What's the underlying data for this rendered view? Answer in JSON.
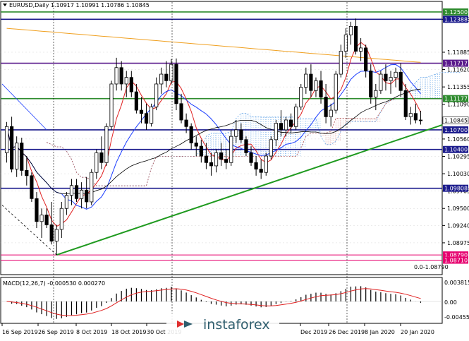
{
  "header": {
    "symbol_line": "EURUSD,Daily  1.10917 1.10991 1.10786 1.10845"
  },
  "macd_label": "MACD(12,26,7) -0.000530 0.000270",
  "macd_axis": [
    "0.003815",
    "0.00",
    "-0.004556"
  ],
  "fib_label": "0.0-1.08790",
  "watermark": "instaforex",
  "colors": {
    "bull": "#ffffff",
    "bear": "#000000",
    "level_blue": "#1a1a8c",
    "level_green": "#2e8b2e",
    "level_purple": "#5a1a8c",
    "level_magenta": "#e6006e",
    "trend": "#1f9a1f",
    "red_ma": "#e02020",
    "blue_ma": "#1a3cff",
    "dark_ma": "#000000",
    "orange_ma": "#f0a020",
    "cloud": "#6aa8e8",
    "price_tag": "#1a1a8c"
  },
  "chart_data": {
    "type": "candlestick",
    "symbol": "EURUSD",
    "timeframe": "Daily",
    "ylim": [
      1.085,
      1.1265
    ],
    "y_ticks": [
      "1.12388",
      "1.11885",
      "1.11620",
      "1.11355",
      "1.11090",
      "1.10560",
      "1.10295",
      "1.10030",
      "1.09765",
      "1.09500",
      "1.09240",
      "1.08975"
    ],
    "x_ticks": [
      "16 Sep 2019",
      "26 Sep 2019",
      "8 Oct 2019",
      "18 Oct 2019",
      "30 Oct 2019",
      "Dec 2019",
      "26 Dec 2019",
      "8 Jan 2020",
      "20 Jan 2020"
    ],
    "last_price": 1.10845,
    "levels": [
      {
        "value": 1.125,
        "label": "1.12500",
        "color": "green"
      },
      {
        "value": 1.12388,
        "label": "1.12388",
        "color": "blue"
      },
      {
        "value": 1.11717,
        "label": "1.11717",
        "color": "purple"
      },
      {
        "value": 1.11177,
        "label": "1.11177",
        "color": "green"
      },
      {
        "value": 1.107,
        "label": "1.10700",
        "color": "blue"
      },
      {
        "value": 1.104,
        "label": "1.10400",
        "color": "blue"
      },
      {
        "value": 1.09808,
        "label": "1.09808",
        "color": "blue"
      },
      {
        "value": 1.0879,
        "label": "1.08790",
        "color": "magenta"
      },
      {
        "value": 1.0871,
        "label": "1.08710",
        "color": "magenta"
      }
    ],
    "trendline": {
      "from": [
        1.0879,
        "26 Sep 2019"
      ],
      "to": [
        1.1084,
        "20 Jan 2020"
      ]
    },
    "candles": [
      [
        1.1035,
        1.1082,
        1.102,
        1.1075
      ],
      [
        1.1075,
        1.109,
        1.1005,
        1.101
      ],
      [
        1.101,
        1.106,
        1.0998,
        1.105
      ],
      [
        1.105,
        1.1058,
        1.1,
        1.1008
      ],
      [
        1.1008,
        1.103,
        1.0985,
        1.1
      ],
      [
        1.1,
        1.1005,
        1.096,
        1.0965
      ],
      [
        1.0965,
        1.0975,
        1.092,
        1.093
      ],
      [
        1.093,
        1.095,
        1.0905,
        1.094
      ],
      [
        1.094,
        1.095,
        1.092,
        1.0925
      ],
      [
        1.0925,
        1.096,
        1.0895,
        1.09
      ],
      [
        1.09,
        1.0925,
        1.0879,
        1.0918
      ],
      [
        1.0918,
        1.096,
        1.0905,
        1.095
      ],
      [
        1.095,
        1.0975,
        1.094,
        1.097
      ],
      [
        1.097,
        1.0995,
        1.0955,
        1.0985
      ],
      [
        1.0985,
        1.0995,
        1.096,
        1.0965
      ],
      [
        1.0965,
        1.099,
        1.095,
        1.0978
      ],
      [
        1.0978,
        1.0998,
        1.095,
        1.096
      ],
      [
        1.096,
        1.101,
        1.0955,
        1.1005
      ],
      [
        1.1005,
        1.104,
        1.0995,
        1.1035
      ],
      [
        1.1035,
        1.106,
        1.101,
        1.102
      ],
      [
        1.102,
        1.108,
        1.1015,
        1.1075
      ],
      [
        1.1075,
        1.1145,
        1.107,
        1.114
      ],
      [
        1.114,
        1.118,
        1.113,
        1.1165
      ],
      [
        1.1165,
        1.1175,
        1.113,
        1.114
      ],
      [
        1.114,
        1.116,
        1.112,
        1.115
      ],
      [
        1.115,
        1.116,
        1.112,
        1.1128
      ],
      [
        1.1128,
        1.114,
        1.1095,
        1.11
      ],
      [
        1.11,
        1.112,
        1.108,
        1.1095
      ],
      [
        1.1095,
        1.111,
        1.107,
        1.108
      ],
      [
        1.108,
        1.111,
        1.1075,
        1.1105
      ],
      [
        1.1105,
        1.115,
        1.11,
        1.114
      ],
      [
        1.114,
        1.1165,
        1.1125,
        1.1155
      ],
      [
        1.1155,
        1.1175,
        1.1135,
        1.1145
      ],
      [
        1.1145,
        1.1178,
        1.114,
        1.117
      ],
      [
        1.117,
        1.1179,
        1.11,
        1.111
      ],
      [
        1.111,
        1.1125,
        1.108,
        1.1085
      ],
      [
        1.1085,
        1.1095,
        1.1065,
        1.1075
      ],
      [
        1.1075,
        1.108,
        1.104,
        1.105
      ],
      [
        1.105,
        1.106,
        1.103,
        1.1045
      ],
      [
        1.1045,
        1.1055,
        1.102,
        1.103
      ],
      [
        1.103,
        1.105,
        1.101,
        1.102
      ],
      [
        1.102,
        1.1035,
        1.1,
        1.1015
      ],
      [
        1.1015,
        1.104,
        1.1005,
        1.1035
      ],
      [
        1.1035,
        1.105,
        1.1015,
        1.1025
      ],
      [
        1.1025,
        1.104,
        1.101,
        1.102
      ],
      [
        1.102,
        1.107,
        1.1015,
        1.106
      ],
      [
        1.106,
        1.1085,
        1.105,
        1.107
      ],
      [
        1.107,
        1.108,
        1.105,
        1.1055
      ],
      [
        1.1055,
        1.106,
        1.103,
        1.1035
      ],
      [
        1.1035,
        1.1045,
        1.1015,
        1.102
      ],
      [
        1.102,
        1.103,
        1.1,
        1.101
      ],
      [
        1.101,
        1.1025,
        1.0995,
        1.1005
      ],
      [
        1.1005,
        1.1035,
        1.1,
        1.103
      ],
      [
        1.103,
        1.106,
        1.1025,
        1.1055
      ],
      [
        1.1055,
        1.1085,
        1.1045,
        1.108
      ],
      [
        1.108,
        1.11,
        1.106,
        1.107
      ],
      [
        1.107,
        1.109,
        1.106,
        1.1085
      ],
      [
        1.1085,
        1.1095,
        1.1065,
        1.1075
      ],
      [
        1.1075,
        1.111,
        1.107,
        1.1105
      ],
      [
        1.1105,
        1.114,
        1.11,
        1.1135
      ],
      [
        1.1135,
        1.1165,
        1.1125,
        1.1155
      ],
      [
        1.1155,
        1.117,
        1.112,
        1.113
      ],
      [
        1.113,
        1.115,
        1.112,
        1.1145
      ],
      [
        1.1145,
        1.116,
        1.111,
        1.112
      ],
      [
        1.112,
        1.114,
        1.108,
        1.109
      ],
      [
        1.109,
        1.111,
        1.1075,
        1.11
      ],
      [
        1.11,
        1.116,
        1.1095,
        1.1155
      ],
      [
        1.1155,
        1.12,
        1.115,
        1.119
      ],
      [
        1.119,
        1.1225,
        1.118,
        1.1215
      ],
      [
        1.1215,
        1.1235,
        1.12,
        1.1228
      ],
      [
        1.1228,
        1.124,
        1.1185,
        1.119
      ],
      [
        1.119,
        1.121,
        1.1175,
        1.1195
      ],
      [
        1.1195,
        1.12,
        1.115,
        1.116
      ],
      [
        1.116,
        1.117,
        1.111,
        1.112
      ],
      [
        1.112,
        1.114,
        1.11,
        1.113
      ],
      [
        1.113,
        1.116,
        1.1125,
        1.1155
      ],
      [
        1.1155,
        1.117,
        1.113,
        1.1145
      ],
      [
        1.1145,
        1.116,
        1.1125,
        1.115
      ],
      [
        1.115,
        1.1165,
        1.1135,
        1.1158
      ],
      [
        1.1158,
        1.1172,
        1.112,
        1.113
      ],
      [
        1.113,
        1.114,
        1.1085,
        1.109
      ],
      [
        1.109,
        1.1105,
        1.1078,
        1.1095
      ],
      [
        1.1095,
        1.111,
        1.108,
        1.1085
      ],
      [
        1.1085,
        1.1099,
        1.1078,
        1.10845
      ]
    ]
  }
}
